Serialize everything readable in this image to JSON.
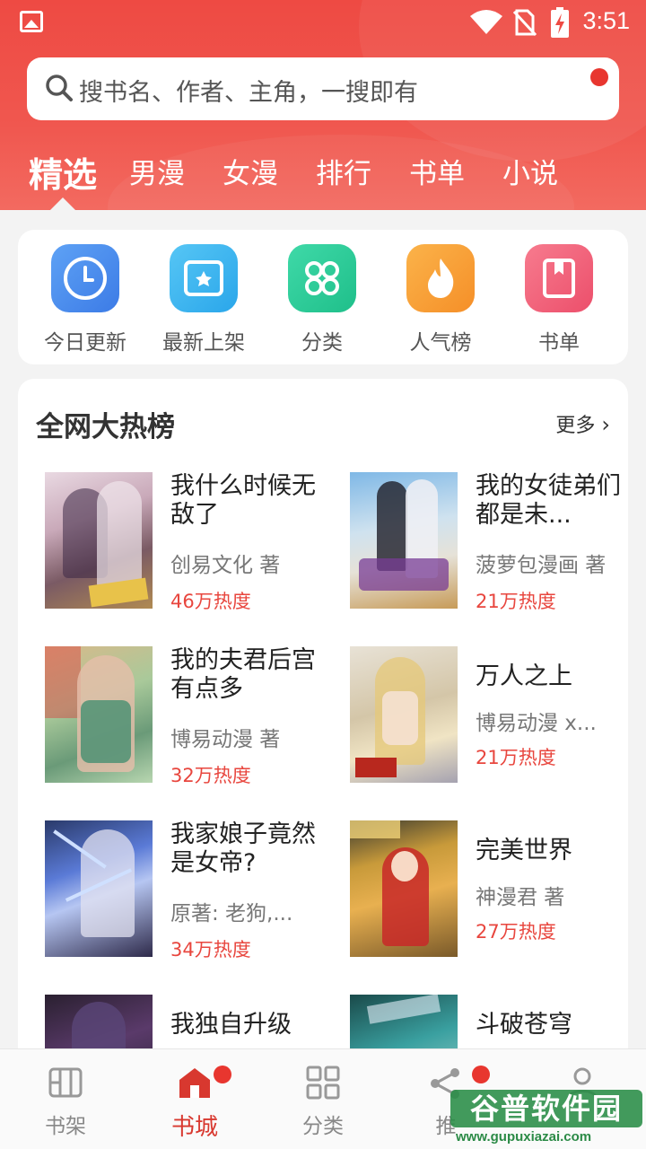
{
  "status_bar": {
    "time": "3:51",
    "icons": [
      "image-icon",
      "wifi-icon",
      "no-sim-icon",
      "battery-charging-icon"
    ]
  },
  "search": {
    "placeholder": "搜书名、作者、主角，一搜即有",
    "icon": "search-icon"
  },
  "tabs": [
    {
      "label": "精选",
      "active": true
    },
    {
      "label": "男漫"
    },
    {
      "label": "女漫"
    },
    {
      "label": "排行"
    },
    {
      "label": "书单"
    },
    {
      "label": "小说"
    }
  ],
  "quick_links": [
    {
      "label": "今日更新",
      "icon": "clock-icon",
      "color": "#4d8ef0"
    },
    {
      "label": "最新上架",
      "icon": "star-box-icon",
      "color": "#3fb6ee"
    },
    {
      "label": "分类",
      "icon": "grid-icon",
      "color": "#2bcf9a"
    },
    {
      "label": "人气榜",
      "icon": "flame-icon",
      "color": "#f7a23b"
    },
    {
      "label": "书单",
      "icon": "bookmark-book-icon",
      "color": "#f0637b"
    }
  ],
  "hot_list": {
    "title": "全网大热榜",
    "more": "更多",
    "books": [
      {
        "title": "我什么时候无敌了",
        "author": "创易文化 著",
        "heat": "46万热度"
      },
      {
        "title": "我的女徒弟们都是未...",
        "author": "菠萝包漫画 著",
        "heat": "21万热度"
      },
      {
        "title": "我的夫君后宫有点多",
        "author": "博易动漫 著",
        "heat": "32万热度"
      },
      {
        "title": "万人之上",
        "author": "博易动漫 x...",
        "heat": "21万热度"
      },
      {
        "title": "我家娘子竟然是女帝?",
        "author": "原著: 老狗,...",
        "heat": "34万热度"
      },
      {
        "title": "完美世界",
        "author": "神漫君 著",
        "heat": "27万热度"
      },
      {
        "title": "我独自升级",
        "author": "",
        "heat": ""
      },
      {
        "title": "斗破苍穹",
        "author": "",
        "heat": ""
      }
    ]
  },
  "bottom_nav": [
    {
      "label": "书架",
      "icon": "bookshelf-icon"
    },
    {
      "label": "书城",
      "icon": "store-icon",
      "active": true
    },
    {
      "label": "分类",
      "icon": "category-icon"
    },
    {
      "label": "推",
      "icon": "share-icon"
    },
    {
      "label": "",
      "icon": "profile-icon"
    }
  ],
  "watermark": {
    "text": "谷普软件园",
    "url": "www.gupuxiazai.com"
  },
  "colors": {
    "brand_red": "#ee4a43",
    "heat_red": "#e8463e",
    "dot_red": "#e8362f"
  }
}
